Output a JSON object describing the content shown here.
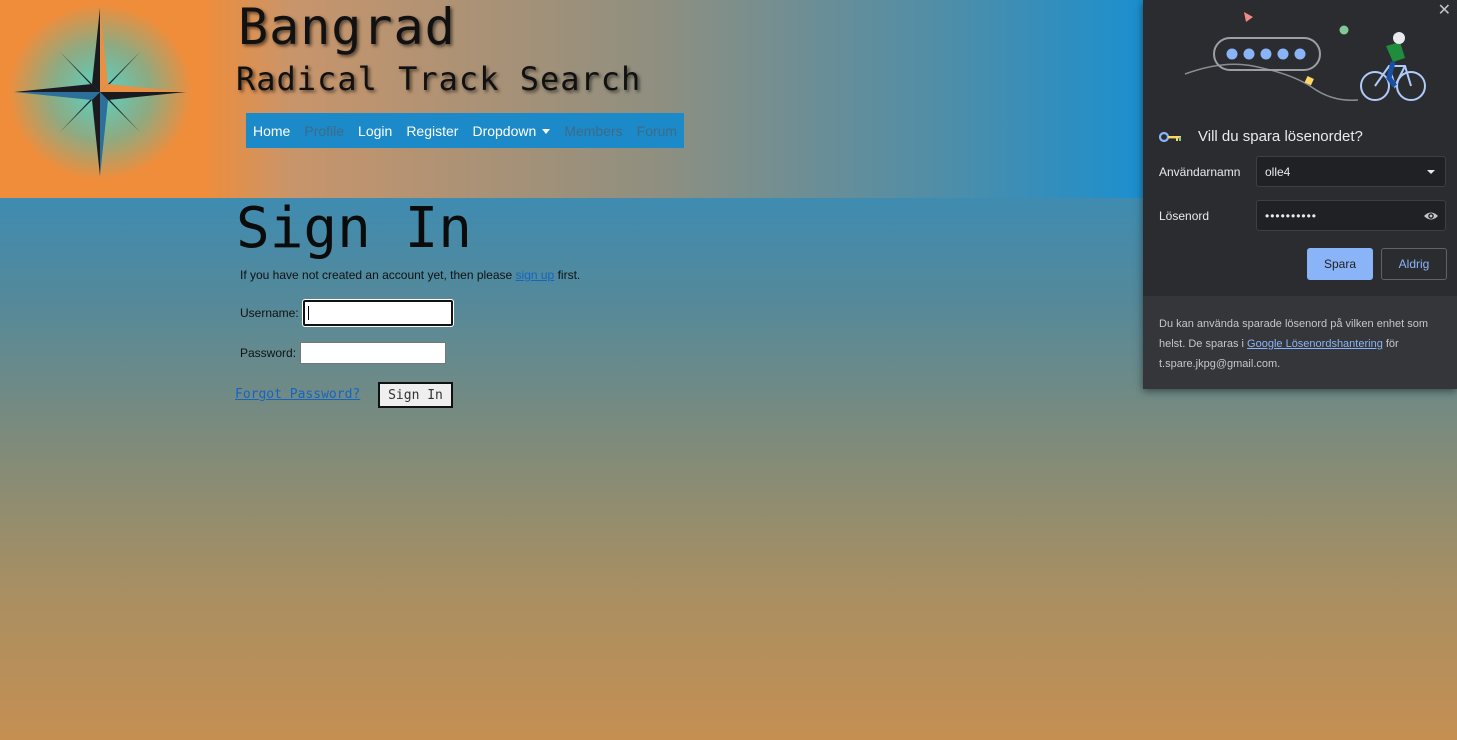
{
  "header": {
    "title": "Bangrad",
    "subtitle": "Radical Track Search"
  },
  "nav": {
    "home": "Home",
    "profile": "Profile",
    "login": "Login",
    "register": "Register",
    "dropdown": "Dropdown",
    "members": "Members",
    "forum": "Forum"
  },
  "signin": {
    "heading": "Sign In",
    "intro_before": "If you have not created an account yet, then please ",
    "intro_link": "sign up",
    "intro_after": " first.",
    "username_label": "Username:",
    "username_value": "",
    "password_label": "Password:",
    "password_value": "",
    "forgot_link": "Forgot Password?",
    "submit_label": "Sign In"
  },
  "password_popup": {
    "close_glyph": "✕",
    "title": "Vill du spara lösenordet?",
    "username_label": "Användarnamn",
    "username_value": "olle4",
    "password_label": "Lösenord",
    "password_value": "••••••••••",
    "save_label": "Spara",
    "never_label": "Aldrig",
    "footer_before": "Du kan använda sparade lösenord på vilken enhet som helst. De sparas i ",
    "footer_link": "Google Lösenordshantering",
    "footer_after": " för t.spare.jkpg@gmail.com.",
    "icons": {
      "key": "key-icon",
      "dropdown": "chevron-down-icon",
      "reveal": "eye-icon",
      "close": "close-icon"
    }
  },
  "colors": {
    "header_orange": "#f08d3a",
    "nav_blue": "#1c8ac8",
    "popup_bg": "#2b2c30",
    "popup_accent": "#8ab4f8"
  }
}
